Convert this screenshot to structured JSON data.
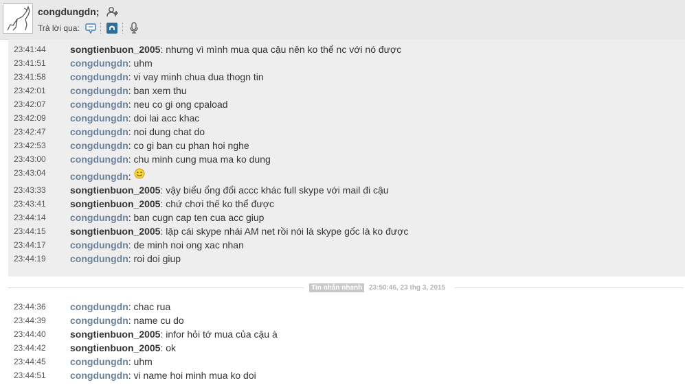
{
  "header": {
    "username": "congdungdn;",
    "reply_via_label": "Trả lời qua:",
    "reply_icons": [
      "chat-bubble-icon",
      "skype-phone-icon",
      "microphone-icon"
    ]
  },
  "colors": {
    "self_name": "#6a819a",
    "other_name": "#333333",
    "block_bg": "#eeeeee"
  },
  "block1": {
    "messages": [
      {
        "time": "23:41:44",
        "author": "songtienbuon_2005",
        "text": ": nhưng vì mình mua qua cậu nên ko thể nc với nó được",
        "self": false
      },
      {
        "time": "23:41:51",
        "author": "congdungdn",
        "text": ": uhm",
        "self": true
      },
      {
        "time": "23:41:58",
        "author": "congdungdn",
        "text": ": vi vay minh chua dua thogn tin",
        "self": true
      },
      {
        "time": "23:42:01",
        "author": "congdungdn",
        "text": ": ban xem thu",
        "self": true
      },
      {
        "time": "23:42:07",
        "author": "congdungdn",
        "text": ": neu co gi ong cpaload",
        "self": true
      },
      {
        "time": "23:42:09",
        "author": "congdungdn",
        "text": ": doi lai acc khac",
        "self": true
      },
      {
        "time": "23:42:47",
        "author": "congdungdn",
        "text": ": noi dung chat do",
        "self": true
      },
      {
        "time": "23:42:53",
        "author": "congdungdn",
        "text": ": co gi ban cu phan hoi nghe",
        "self": true
      },
      {
        "time": "23:43:00",
        "author": "congdungdn",
        "text": ": chu minh cung mua ma ko dung",
        "self": true
      },
      {
        "time": "23:43:04",
        "author": "congdungdn",
        "text": ": ",
        "self": true,
        "emoticon": "smile-emoticon"
      },
      {
        "time": "23:43:33",
        "author": "songtienbuon_2005",
        "text": ": vậy biểu ổng đổi accc khác full skype với mail đi cậu",
        "self": false
      },
      {
        "time": "23:43:41",
        "author": "songtienbuon_2005",
        "text": ": chứ chơi thế ko thể được",
        "self": false
      },
      {
        "time": "23:44:14",
        "author": "congdungdn",
        "text": ": ban cugn cap ten cua acc giup",
        "self": true
      },
      {
        "time": "23:44:15",
        "author": "songtienbuon_2005",
        "text": ": lập cái skype nhái AM net rồi nói là skype gốc là ko được",
        "self": false
      },
      {
        "time": "23:44:17",
        "author": "congdungdn",
        "text": ": de minh noi ong xac nhan",
        "self": true
      },
      {
        "time": "23:44:19",
        "author": "congdungdn",
        "text": ": roi doi giup",
        "self": true
      }
    ]
  },
  "divider": {
    "label": "Tin nhắn nhanh",
    "timestamp": "23:50:46, 23 thg 3, 2015"
  },
  "block2": {
    "messages": [
      {
        "time": "23:44:36",
        "author": "congdungdn",
        "text": ": chac rua",
        "self": true
      },
      {
        "time": "23:44:39",
        "author": "congdungdn",
        "text": ": name cu do",
        "self": true
      },
      {
        "time": "23:44:40",
        "author": "songtienbuon_2005",
        "text": ": infor hỏi tớ mua của cậu à",
        "self": false
      },
      {
        "time": "23:44:42",
        "author": "songtienbuon_2005",
        "text": ": ok",
        "self": false
      },
      {
        "time": "23:44:45",
        "author": "congdungdn",
        "text": ": uhm",
        "self": true
      },
      {
        "time": "23:44:51",
        "author": "congdungdn",
        "text": ": vi name hoi minh mua ko doi",
        "self": true
      }
    ]
  }
}
